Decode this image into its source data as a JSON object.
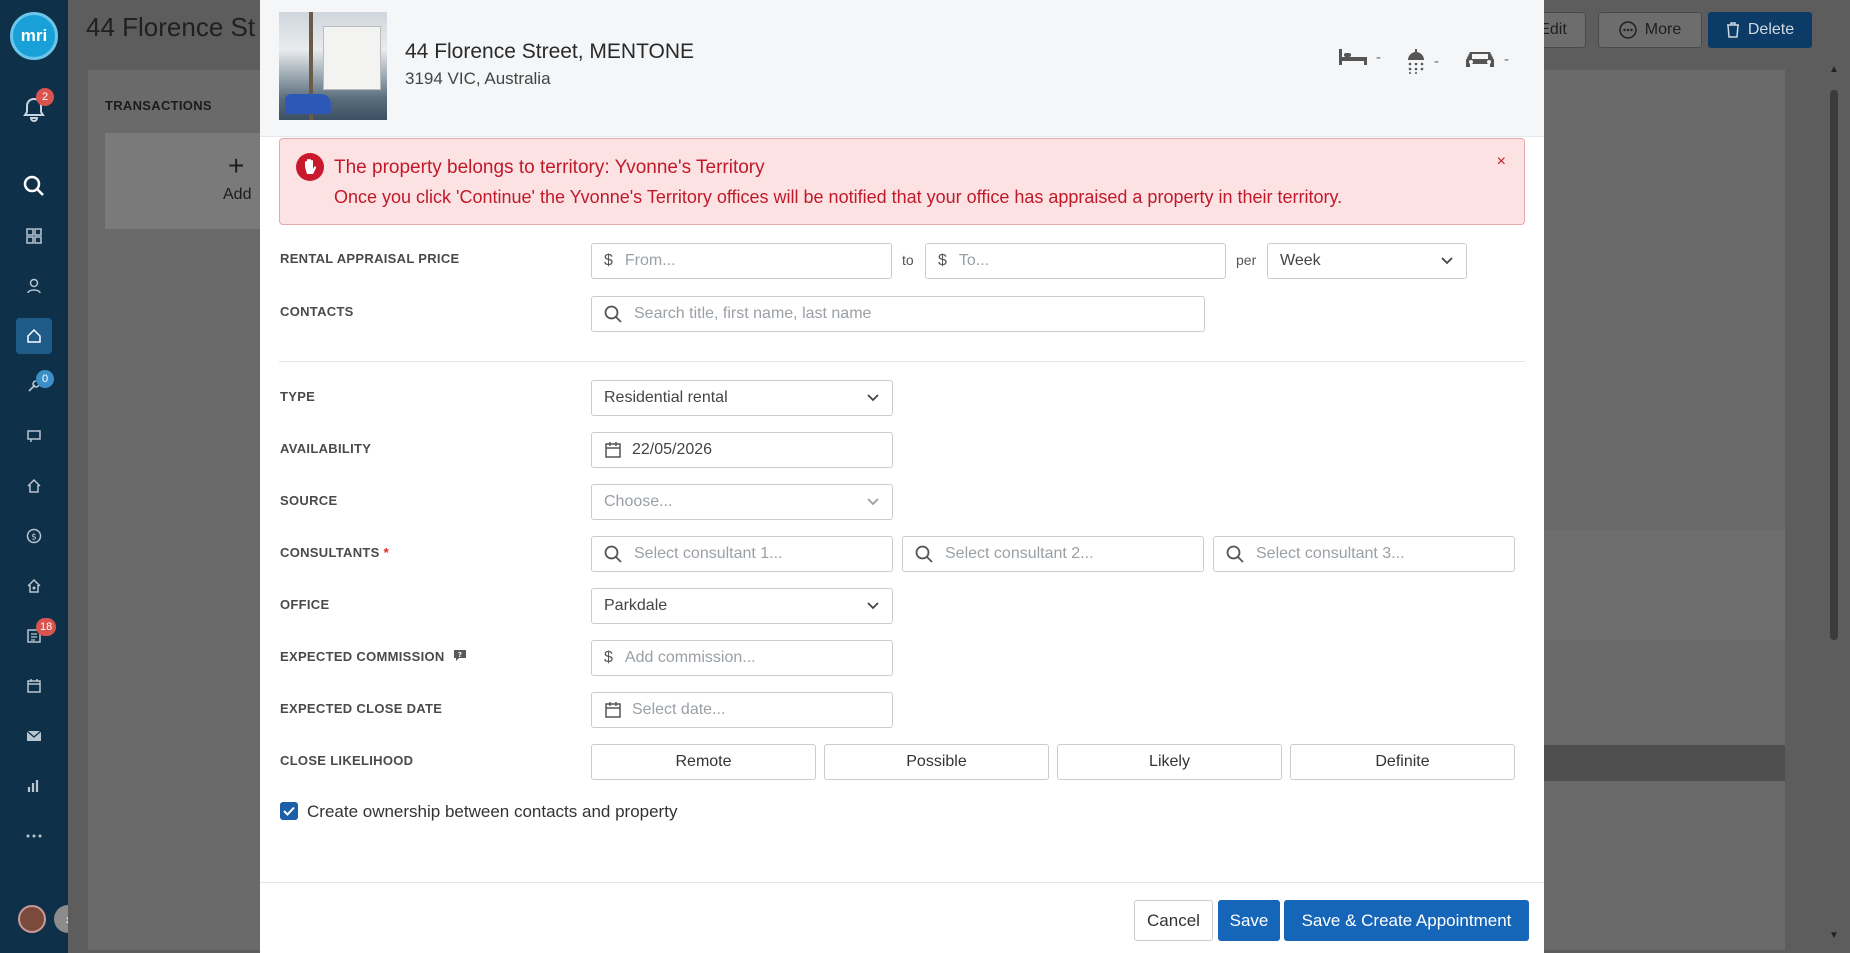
{
  "app": {
    "logo_text": "mri",
    "notification_count": "2",
    "tools_badge": "0",
    "tasks_badge": "18",
    "page_title": "44 Florence St",
    "transactions_label": "TRANSACTIONS",
    "add_label": "Add",
    "actions": {
      "edit": "Edit",
      "more": "More",
      "delete": "Delete"
    }
  },
  "property": {
    "address": "44 Florence Street, MENTONE",
    "locality": "3194 VIC, Australia",
    "bedrooms": "-",
    "bathrooms": "-",
    "car_spaces": "-"
  },
  "alert": {
    "title": "The property belongs to territory: Yvonne's Territory",
    "body": "Once you click 'Continue' the Yvonne's Territory offices will be notified that your office has appraised a property in their territory.",
    "close": "×"
  },
  "form": {
    "rental_price": {
      "label": "RENTAL APPRAISAL PRICE",
      "currency": "$",
      "from_placeholder": "From...",
      "to_text": "to",
      "to_placeholder": "To...",
      "per_text": "per",
      "period": "Week"
    },
    "contacts": {
      "label": "CONTACTS",
      "placeholder": "Search title, first name, last name"
    },
    "type": {
      "label": "TYPE",
      "value": "Residential rental"
    },
    "availability": {
      "label": "AVAILABILITY",
      "value": "22/05/2026"
    },
    "source": {
      "label": "SOURCE",
      "placeholder": "Choose..."
    },
    "consultants": {
      "label": "CONSULTANTS",
      "required_mark": "*",
      "placeholders": [
        "Select consultant 1...",
        "Select consultant 2...",
        "Select consultant 3..."
      ]
    },
    "office": {
      "label": "OFFICE",
      "value": "Parkdale"
    },
    "commission": {
      "label": "EXPECTED COMMISSION",
      "currency": "$",
      "placeholder": "Add commission..."
    },
    "close_date": {
      "label": "EXPECTED CLOSE DATE",
      "placeholder": "Select date..."
    },
    "close_likelihood": {
      "label": "CLOSE LIKELIHOOD",
      "options": [
        "Remote",
        "Possible",
        "Likely",
        "Definite"
      ]
    },
    "ownership_checkbox": {
      "label": "Create ownership between contacts and property",
      "checked": true
    }
  },
  "footer": {
    "cancel": "Cancel",
    "save": "Save",
    "save_create": "Save & Create Appointment"
  }
}
